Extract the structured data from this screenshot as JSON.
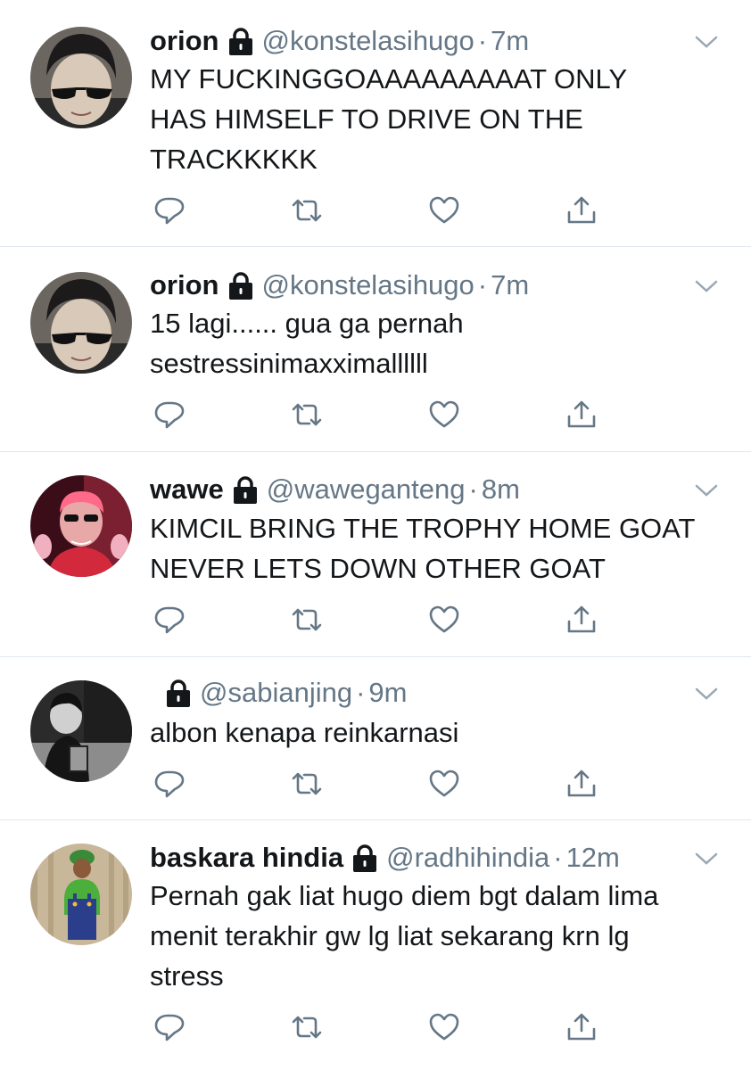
{
  "tweets": [
    {
      "name": "orion",
      "handle": "@konstelasihugo",
      "separator": "·",
      "time": "7m",
      "text": "MY FUCKINGGOAAAAAAAAAT ONLY\nHAS HIMSELF TO DRIVE ON THE\nTRACKKKKK",
      "avatar_icon": "avatar-orion"
    },
    {
      "name": "orion",
      "handle": "@konstelasihugo",
      "separator": "·",
      "time": "7m",
      "text": "15 lagi...... gua ga pernah\nsestressinimaxximallllll",
      "avatar_icon": "avatar-orion"
    },
    {
      "name": "wawe",
      "handle": "@waweganteng",
      "separator": "·",
      "time": "8m",
      "text": "KIMCIL BRING THE TROPHY HOME GOAT\nNEVER LETS DOWN OTHER GOAT",
      "avatar_icon": "avatar-wawe"
    },
    {
      "name": "",
      "handle": "@sabianjing",
      "separator": "·",
      "time": "9m",
      "text": "albon kenapa reinkarnasi",
      "avatar_icon": "avatar-sabianjing"
    },
    {
      "name": "baskara hindia",
      "handle": "@radhihindia",
      "separator": "·",
      "time": "12m",
      "text": "Pernah gak liat hugo diem bgt dalam lima\nmenit terakhir gw lg liat sekarang krn lg\nstress",
      "avatar_icon": "avatar-baskara"
    }
  ],
  "colors": {
    "text": "#14171a",
    "secondary": "#657786",
    "divider": "#e1e8ed"
  },
  "icons": [
    "lock-icon",
    "chevron-down-icon",
    "reply-icon",
    "retweet-icon",
    "like-icon",
    "share-icon"
  ]
}
